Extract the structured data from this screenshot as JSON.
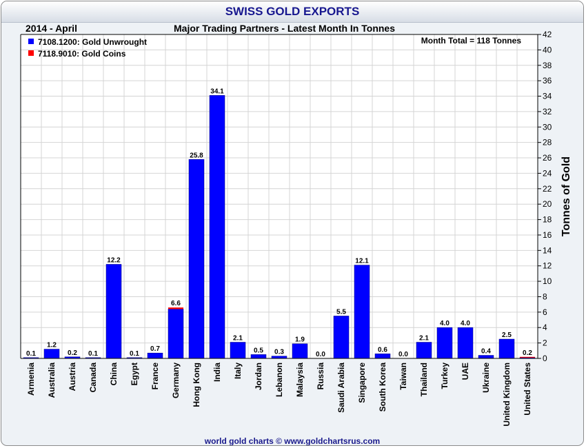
{
  "header": {
    "title": "SWISS GOLD EXPORTS",
    "period": "2014 - April",
    "subtitle": "Major Trading Partners - Latest Month In Tonnes"
  },
  "footer": "world gold charts © www.goldchartsrus.com",
  "chart_data": {
    "type": "bar",
    "stacked": true,
    "categories": [
      "Armenia",
      "Australia",
      "Austria",
      "Canada",
      "China",
      "Egypt",
      "France",
      "Germany",
      "Hong Kong",
      "India",
      "Italy",
      "Jordan",
      "Lebanon",
      "Malaysia",
      "Russia",
      "Saudi Arabia",
      "Singapore",
      "South Korea",
      "Taiwan",
      "Thailand",
      "Turkey",
      "UAE",
      "Ukraine",
      "United Kingdom",
      "United States"
    ],
    "series": [
      {
        "name": "7108.1200: Gold Unwrought",
        "color": "#0000ff",
        "values": [
          0.1,
          1.2,
          0.2,
          0.1,
          12.2,
          0.1,
          0.7,
          6.4,
          25.8,
          34.1,
          2.1,
          0.5,
          0.3,
          1.9,
          0.0,
          5.5,
          12.1,
          0.6,
          0.0,
          2.1,
          4.0,
          4.0,
          0.4,
          2.5,
          0.1
        ]
      },
      {
        "name": "7118.9010: Gold Coins",
        "color": "#ff0000",
        "values": [
          0,
          0,
          0,
          0,
          0,
          0,
          0,
          0.2,
          0,
          0,
          0,
          0,
          0,
          0,
          0,
          0,
          0,
          0,
          0,
          0,
          0,
          0,
          0,
          0,
          0.1
        ]
      }
    ],
    "data_labels": [
      "0.1",
      "1.2",
      "0.2",
      "0.1",
      "12.2",
      "0.1",
      "0.7",
      "6.6",
      "25.8",
      "34.1",
      "2.1",
      "0.5",
      "0.3",
      "1.9",
      "0.0",
      "5.5",
      "12.1",
      "0.6",
      "0.0",
      "2.1",
      "4.0",
      "4.0",
      "0.4",
      "2.5",
      "0.2"
    ],
    "annotation": "Month Total = 118 Tonnes",
    "ylabel": "Tonnes of Gold",
    "ylim": [
      0,
      42
    ],
    "ytick_step": 2,
    "y_axis_side": "right",
    "legend_position": "top-left",
    "grid": true
  }
}
